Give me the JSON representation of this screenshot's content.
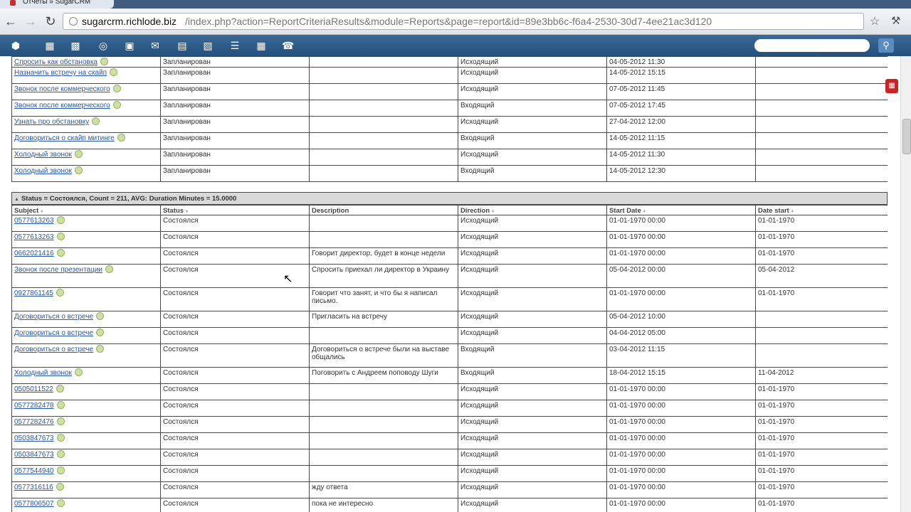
{
  "browser": {
    "tab_title": "Отчеты » SugarCRM",
    "url_host": "sugarcrm.richlode.biz",
    "url_path": "/index.php?action=ReportCriteriaResults&module=Reports&page=report&id=89e3bb6c-f6a4-2530-30d7-4ee21ac3d120"
  },
  "sugar_toolbar": {
    "icons": [
      "cube-icon",
      "building-icon",
      "contact-card-icon",
      "target-icon",
      "briefcase-icon",
      "mail-icon",
      "document-icon",
      "book-icon",
      "notes-icon",
      "calendar-icon",
      "phone-icon"
    ],
    "search_placeholder": ""
  },
  "group1": {
    "rows": [
      {
        "subject": "Спросить как обстановка",
        "status": "Запланирован",
        "description": "",
        "direction": "Исходящий",
        "start": "04-05-2012 11:30",
        "date_start": ""
      },
      {
        "subject": "Назначить встречу на скайп",
        "status": "Запланирован",
        "description": "",
        "direction": "Исходящий",
        "start": "14-05-2012 15:15",
        "date_start": ""
      },
      {
        "subject": "Звонок после коммерческого",
        "status": "Запланирован",
        "description": "",
        "direction": "Исходящий",
        "start": "07-05-2012 11:45",
        "date_start": ""
      },
      {
        "subject": "Звонок после коммерческого",
        "status": "Запланирован",
        "description": "",
        "direction": "Входящий",
        "start": "07-05-2012 17:45",
        "date_start": ""
      },
      {
        "subject": "Узнать про обстановку",
        "status": "Запланирован",
        "description": "",
        "direction": "Исходящий",
        "start": "27-04-2012 12:00",
        "date_start": ""
      },
      {
        "subject": "Договориться о скайп митинге",
        "status": "Запланирован",
        "description": "",
        "direction": "Входящий",
        "start": "14-05-2012 11:15",
        "date_start": ""
      },
      {
        "subject": "Холодный звонок",
        "status": "Запланирован",
        "description": "",
        "direction": "Исходящий",
        "start": "14-05-2012 11:30",
        "date_start": ""
      },
      {
        "subject": "Холодный звонок",
        "status": "Запланирован",
        "description": "",
        "direction": "Входящий",
        "start": "14-05-2012 12:30",
        "date_start": ""
      }
    ]
  },
  "group2": {
    "header": "Status = Состоялся, Count = 211, AVG: Duration Minutes = 15.0000",
    "columns": [
      "Subject",
      "Status",
      "Description",
      "Direction",
      "Start Date",
      "Date start"
    ],
    "rows": [
      {
        "subject": "0577613263",
        "status": "Состоялся",
        "description": "",
        "direction": "Исходящий",
        "start": "01-01-1970 00:00",
        "date_start": "01-01-1970"
      },
      {
        "subject": "0577613263",
        "status": "Состоялся",
        "description": "",
        "direction": "Исходящий",
        "start": "01-01-1970 00:00",
        "date_start": "01-01-1970"
      },
      {
        "subject": "0662021416",
        "status": "Состоялся",
        "description": "Говорит директор, будет в конце недели",
        "direction": "Исходящий",
        "start": "01-01-1970 00:00",
        "date_start": "01-01-1970"
      },
      {
        "subject": "Звонок после презентации",
        "status": "Состоялся",
        "description": "Спросить приехал ли директор в Украину",
        "direction": "Исходящий",
        "start": "05-04-2012 00:00",
        "date_start": "05-04-2012"
      },
      {
        "subject": "0927861145",
        "status": "Состоялся",
        "description": "Говорит что занят, и что бы я написал письмо.",
        "direction": "Исходящий",
        "start": "01-01-1970 00:00",
        "date_start": "01-01-1970"
      },
      {
        "subject": "Договориться о встрече",
        "status": "Состоялся",
        "description": "Пригласить на встречу",
        "direction": "Исходящий",
        "start": "05-04-2012 10:00",
        "date_start": ""
      },
      {
        "subject": "Договориться о встрече",
        "status": "Состоялся",
        "description": "",
        "direction": "Исходящий",
        "start": "04-04-2012 05:00",
        "date_start": ""
      },
      {
        "subject": "Договориться о встрече",
        "status": "Состоялся",
        "description": "Договориться о встрече были на выставе общались",
        "direction": "Входящий",
        "start": "03-04-2012 11:15",
        "date_start": ""
      },
      {
        "subject": "Холодный звонок",
        "status": "Состоялся",
        "description": "Поговорить с Андреем поповоду Шуги",
        "direction": "Входящий",
        "start": "18-04-2012 15:15",
        "date_start": "11-04-2012"
      },
      {
        "subject": "0505011522",
        "status": "Состоялся",
        "description": "",
        "direction": "Исходящий",
        "start": "01-01-1970 00:00",
        "date_start": "01-01-1970"
      },
      {
        "subject": "0577282478",
        "status": "Состоялся",
        "description": "",
        "direction": "Исходящий",
        "start": "01-01-1970 00:00",
        "date_start": "01-01-1970"
      },
      {
        "subject": "0577282476",
        "status": "Состоялся",
        "description": "",
        "direction": "Исходящий",
        "start": "01-01-1970 00:00",
        "date_start": "01-01-1970"
      },
      {
        "subject": "0503847673",
        "status": "Состоялся",
        "description": "",
        "direction": "Исходящий",
        "start": "01-01-1970 00:00",
        "date_start": "01-01-1970"
      },
      {
        "subject": "0503847673",
        "status": "Состоялся",
        "description": "",
        "direction": "Исходящий",
        "start": "01-01-1970 00:00",
        "date_start": "01-01-1970"
      },
      {
        "subject": "0577544940",
        "status": "Состоялся",
        "description": "",
        "direction": "Исходящий",
        "start": "01-01-1970 00:00",
        "date_start": "01-01-1970"
      },
      {
        "subject": "0577316116",
        "status": "Состоялся",
        "description": "жду ответа",
        "direction": "Исходящий",
        "start": "01-01-1970 00:00",
        "date_start": "01-01-1970"
      },
      {
        "subject": "0577806507",
        "status": "Состоялся",
        "description": "пока не интересно",
        "direction": "Исходящий",
        "start": "01-01-1970 00:00",
        "date_start": "01-01-1970"
      }
    ]
  }
}
